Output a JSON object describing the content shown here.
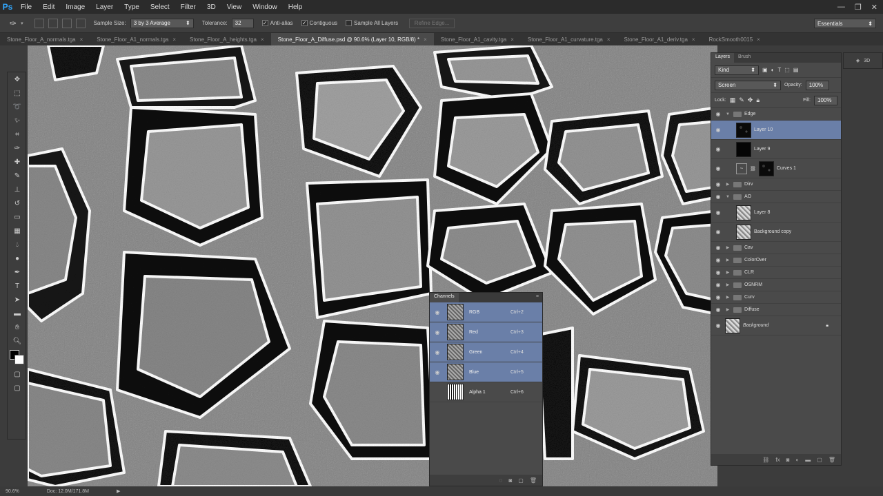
{
  "app": {
    "logo": "Ps"
  },
  "menu": [
    "File",
    "Edit",
    "Image",
    "Layer",
    "Type",
    "Select",
    "Filter",
    "3D",
    "View",
    "Window",
    "Help"
  ],
  "options": {
    "sample_size_label": "Sample Size:",
    "sample_size_value": "3 by 3 Average",
    "tolerance_label": "Tolerance:",
    "tolerance_value": "32",
    "anti_alias": "Anti-alias",
    "contiguous": "Contiguous",
    "sample_all_layers": "Sample All Layers",
    "refine_edge": "Refine Edge...",
    "workspace": "Essentials"
  },
  "tabs": [
    {
      "label": "Stone_Floor_A_normals.tga",
      "active": false
    },
    {
      "label": "Stone_Floor_A1_normals.tga",
      "active": false
    },
    {
      "label": "Stone_Floor_A_heights.tga",
      "active": false
    },
    {
      "label": "Stone_Floor_A_Diffuse.psd @ 90.6% (Layer 10, RGB/8) *",
      "active": true
    },
    {
      "label": "Stone_Floor_A1_cavity.tga",
      "active": false
    },
    {
      "label": "Stone_Floor_A1_curvature.tga",
      "active": false
    },
    {
      "label": "Stone_Floor_A1_deriv.tga",
      "active": false
    },
    {
      "label": "RockSmooth0015",
      "active": false
    }
  ],
  "status": {
    "zoom": "90.6%",
    "doc": "Doc: 12.0M/171.8M"
  },
  "layers_panel": {
    "tabs": [
      "Layers",
      "Brush"
    ],
    "filter": "Kind",
    "blend_mode": "Screen",
    "opacity_label": "Opacity:",
    "opacity_value": "100%",
    "lock_label": "Lock:",
    "fill_label": "Fill:",
    "fill_value": "100%",
    "layers": [
      {
        "name": "Edge",
        "type": "group",
        "open": true,
        "indent": 0
      },
      {
        "name": "Layer 10",
        "type": "layer",
        "indent": 1,
        "selected": true,
        "thumb": "dark-noise"
      },
      {
        "name": "Layer 9",
        "type": "layer",
        "indent": 1,
        "thumb": "black"
      },
      {
        "name": "Curves 1",
        "type": "adjustment",
        "indent": 1,
        "thumb": "dark-noise"
      },
      {
        "name": "Dirv",
        "type": "group",
        "open": false,
        "indent": 0
      },
      {
        "name": "AO",
        "type": "group",
        "open": true,
        "indent": 0
      },
      {
        "name": "Layer 8",
        "type": "layer",
        "indent": 1,
        "thumb": "light-noise"
      },
      {
        "name": "Background copy",
        "type": "layer",
        "indent": 1,
        "thumb": "light-noise"
      },
      {
        "name": "Cav",
        "type": "group",
        "open": false,
        "indent": 0
      },
      {
        "name": "ColorOver",
        "type": "group",
        "open": false,
        "indent": 0
      },
      {
        "name": "CLR",
        "type": "group",
        "open": false,
        "indent": 0
      },
      {
        "name": "OSNRM",
        "type": "group",
        "open": false,
        "indent": 0
      },
      {
        "name": "Curv",
        "type": "group",
        "open": false,
        "indent": 0
      },
      {
        "name": "Diffuse",
        "type": "group",
        "open": false,
        "indent": 0
      },
      {
        "name": "Background",
        "type": "background",
        "indent": 0,
        "thumb": "light-noise",
        "locked": true
      }
    ]
  },
  "side_strip": {
    "label": "3D"
  },
  "channels_panel": {
    "title": "Channels",
    "channels": [
      {
        "name": "RGB",
        "key": "Ctrl+2",
        "selected": true
      },
      {
        "name": "Red",
        "key": "Ctrl+3",
        "selected": true
      },
      {
        "name": "Green",
        "key": "Ctrl+4",
        "selected": true
      },
      {
        "name": "Blue",
        "key": "Ctrl+5",
        "selected": true
      },
      {
        "name": "Alpha 1",
        "key": "Ctrl+6",
        "selected": false
      }
    ]
  },
  "colors": {
    "accent": "#31a8ff",
    "selection": "#6a7fa8",
    "panel_bg": "#4a4a4a"
  }
}
